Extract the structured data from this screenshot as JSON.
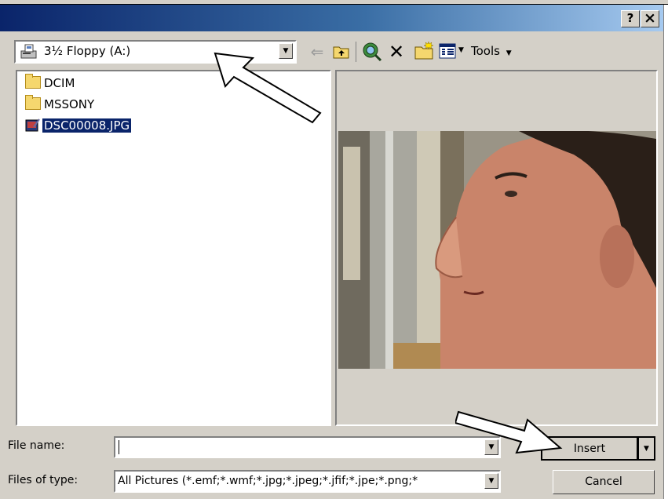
{
  "title_buttons": {
    "help": "?",
    "close": "×"
  },
  "look_in": {
    "value": "3½ Floppy (A:)"
  },
  "toolbar": {
    "tools_label": "Tools"
  },
  "files": [
    {
      "name": "DCIM",
      "type": "folder"
    },
    {
      "name": "MSSONY",
      "type": "folder"
    },
    {
      "name": "DSC00008.JPG",
      "type": "jpg",
      "selected": true
    }
  ],
  "file_name": {
    "label": "File name:",
    "value": ""
  },
  "files_of_type": {
    "label": "Files of type:",
    "value": "All Pictures (*.emf;*.wmf;*.jpg;*.jpeg;*.jfif;*.jpe;*.png;*"
  },
  "buttons": {
    "insert": "Insert",
    "cancel": "Cancel"
  },
  "colors": {
    "titlebar": "#0a246a",
    "selection": "#0a246a",
    "dialog": "#d4d0c8"
  }
}
